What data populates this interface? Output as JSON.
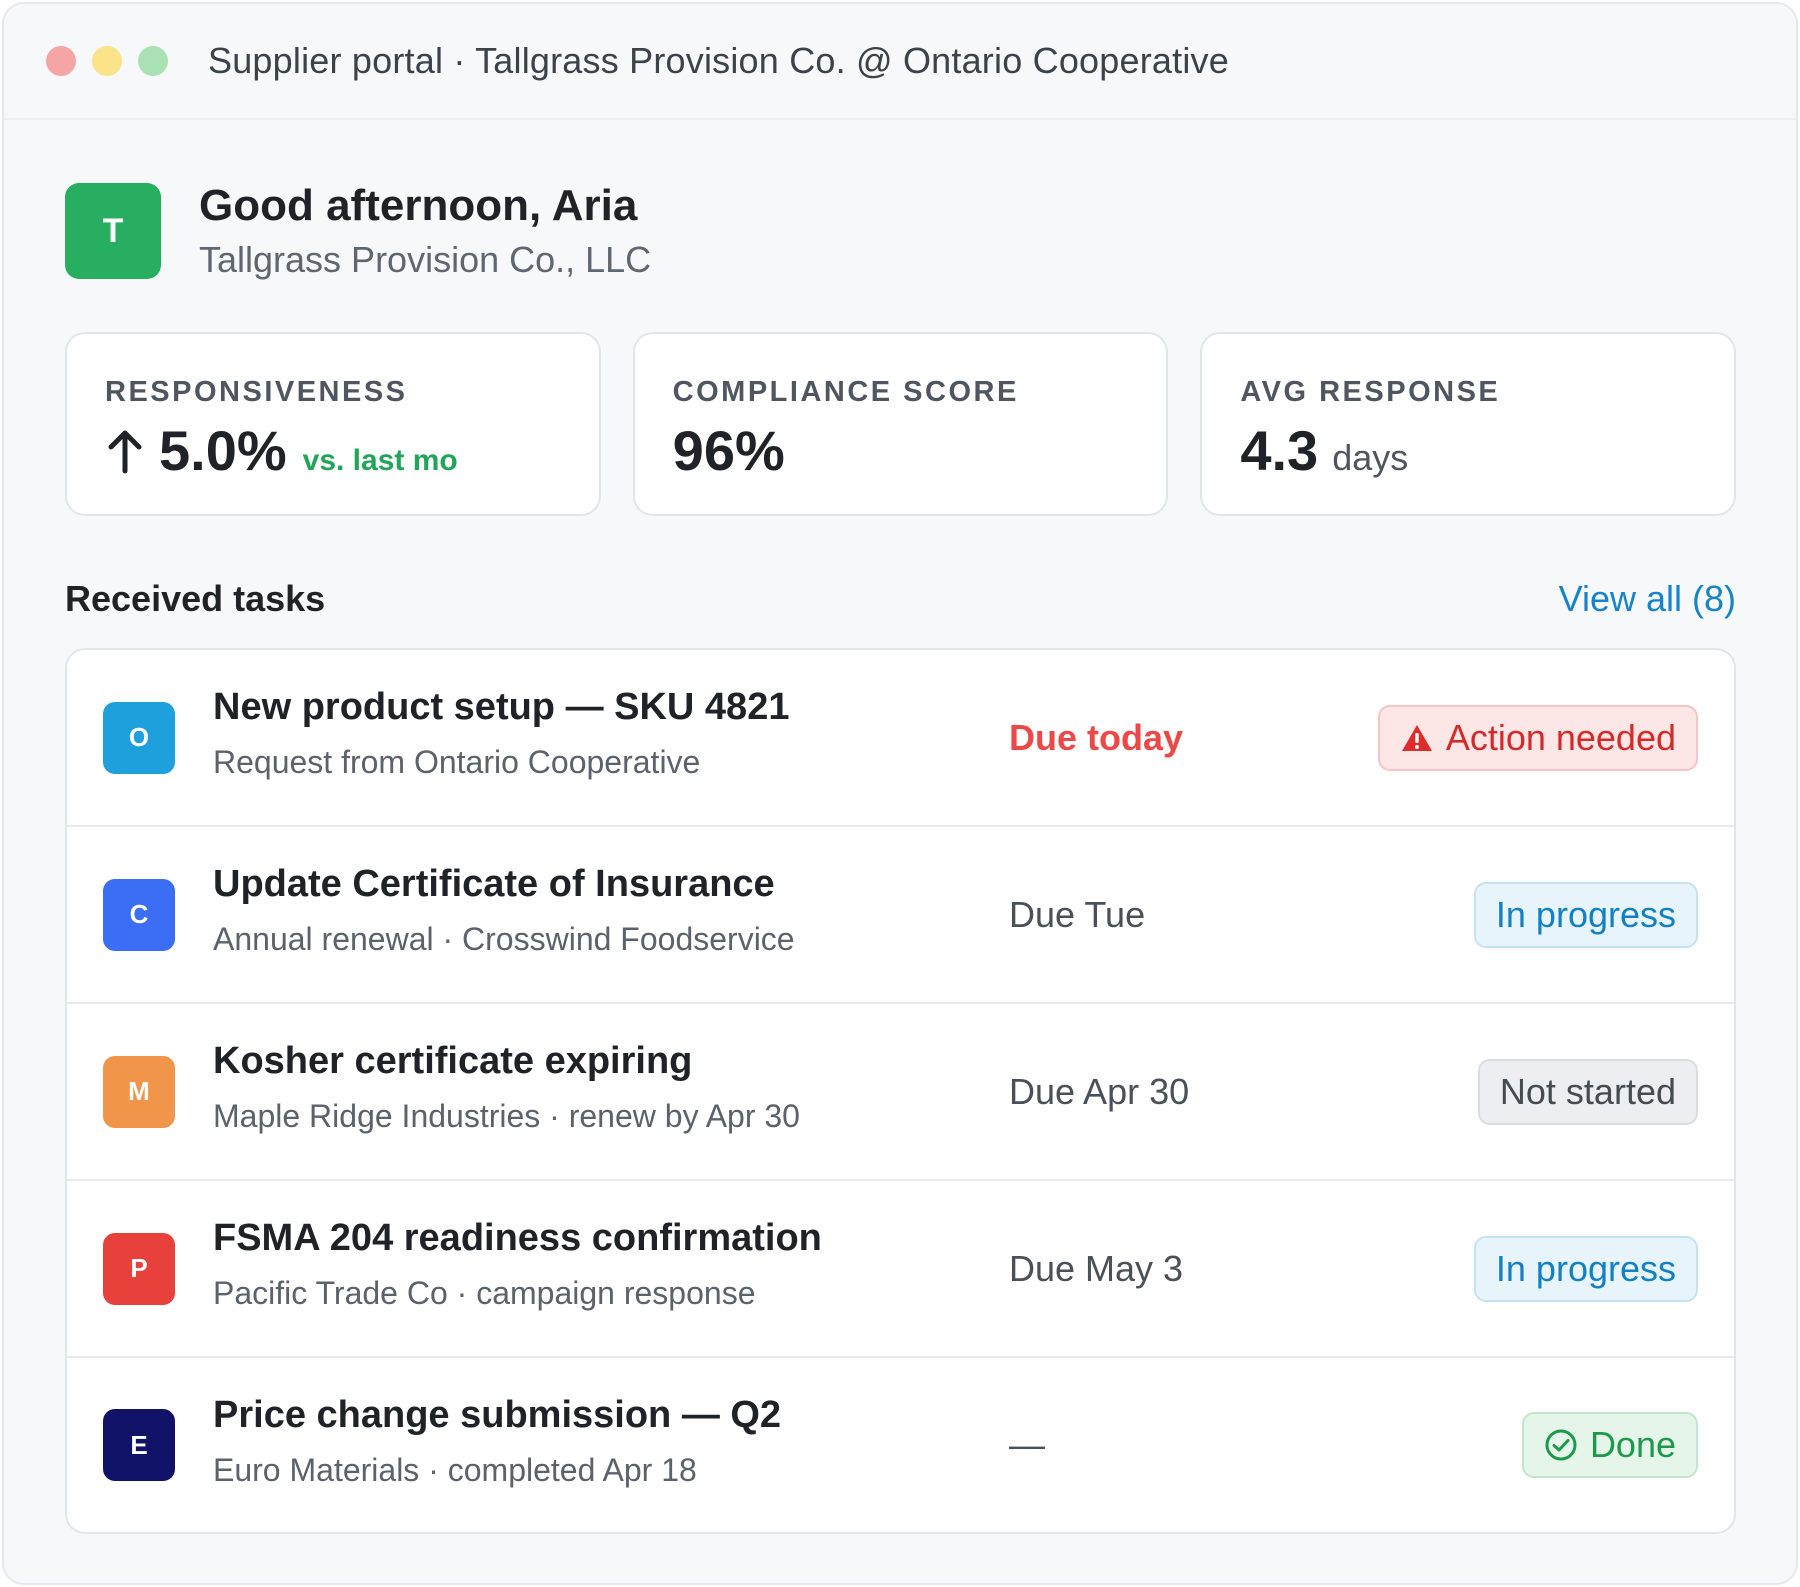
{
  "window": {
    "title": "Supplier portal · Tallgrass Provision Co. @ Ontario Cooperative"
  },
  "greeting": {
    "avatar_letter": "T",
    "title": "Good afternoon, Aria",
    "company": "Tallgrass Provision Co., LLC"
  },
  "stats": [
    {
      "label": "RESPONSIVENESS",
      "value": "5.0%",
      "delta": "vs. last mo",
      "icon": "arrow-up-icon"
    },
    {
      "label": "COMPLIANCE SCORE",
      "value": "96%"
    },
    {
      "label": "AVG RESPONSE",
      "value": "4.3",
      "unit": "days"
    }
  ],
  "tasks": {
    "title": "Received tasks",
    "view_all": "View all (8)",
    "items": [
      {
        "letter": "O",
        "color": "#1ea0dd",
        "title": "New product setup — SKU 4821",
        "subtitle": "Request from Ontario Cooperative",
        "due": "Due today",
        "status": "Action needed",
        "status_type": "action"
      },
      {
        "letter": "C",
        "color": "#3b6ef5",
        "title": "Update Certificate of Insurance",
        "subtitle": "Annual renewal · Crosswind Foodservice",
        "due": "Due Tue",
        "status": "In progress",
        "status_type": "progress"
      },
      {
        "letter": "M",
        "color": "#f0954a",
        "title": "Kosher certificate expiring",
        "subtitle": "Maple Ridge Industries · renew by Apr 30",
        "due": "Due Apr 30",
        "status": "Not started",
        "status_type": "notstarted"
      },
      {
        "letter": "P",
        "color": "#e8403b",
        "title": "FSMA 204 readiness confirmation",
        "subtitle": "Pacific Trade Co · campaign response",
        "due": "Due May 3",
        "status": "In progress",
        "status_type": "progress"
      },
      {
        "letter": "E",
        "color": "#0f1266",
        "title": "Price change submission — Q2",
        "subtitle": "Euro Materials · completed Apr 18",
        "due": "—",
        "status": "Done",
        "status_type": "done"
      }
    ]
  }
}
